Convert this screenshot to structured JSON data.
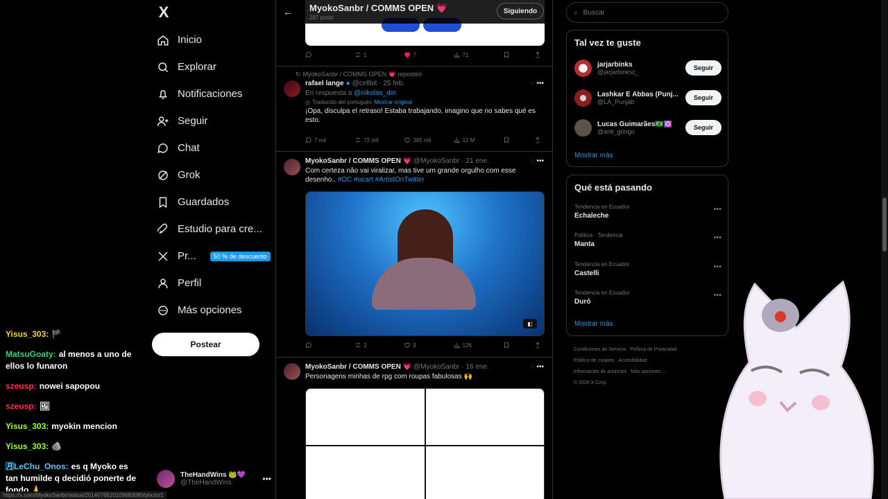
{
  "window_title": "MyokoSanbr / COMMS OPEN",
  "nav": {
    "logo": "X",
    "items": [
      {
        "label": "Inicio",
        "icon": "home-icon"
      },
      {
        "label": "Explorar",
        "icon": "search-icon"
      },
      {
        "label": "Notificaciones",
        "icon": "bell-icon"
      },
      {
        "label": "Seguir",
        "icon": "add-user-icon"
      },
      {
        "label": "Chat",
        "icon": "chat-icon"
      },
      {
        "label": "Grok",
        "icon": "grok-icon"
      },
      {
        "label": "Guardados",
        "icon": "bookmark-icon"
      },
      {
        "label": "Estudio para cre...",
        "icon": "rocket-icon"
      },
      {
        "label": "Pr...",
        "icon": "x-icon",
        "badge": "50 % de descuento"
      },
      {
        "label": "Perfil",
        "icon": "user-icon"
      },
      {
        "label": "Más opciones",
        "icon": "more-icon"
      }
    ],
    "post_button": "Postear",
    "account": {
      "name": "TheHandWins 🐸💜",
      "handle": "@TheHandWins"
    }
  },
  "chat": [
    {
      "user": "Yisus_303:",
      "text": "🏴",
      "color": "#f2d52a"
    },
    {
      "user": "MatsuGoaty:",
      "text": "al menos a uno de ellos lo funaron",
      "color": "#31d37d"
    },
    {
      "user": "szeusp:",
      "text": "nowei sapopou",
      "color": "#ff2e4f"
    },
    {
      "user": "szeusp:",
      "text": "🖼",
      "color": "#ff2e4f"
    },
    {
      "user": "Yisus_303:",
      "text": "myokin mencion",
      "color": "#9aff2d"
    },
    {
      "user": "Yisus_303:",
      "text": "🪨",
      "color": "#9aff2d"
    },
    {
      "user": "🈷LeChu_Onos:",
      "text": "es q Myoko es tan humilde q decidió ponerte de fondo 🙏",
      "color": "#58c7ff"
    }
  ],
  "status_url": "https://x.com/MyokoSanbr/status/2014076520109683080/photo/1",
  "header": {
    "title": "MyokoSanbr / COMMS OPEN 💗",
    "subtitle": "287 posts",
    "follow": "Siguiendo"
  },
  "tweet0": {
    "replies": "",
    "reposts": "1",
    "likes": "7",
    "views": "71"
  },
  "tweet1": {
    "repost_note": "MyokoSanbr / COMMS OPEN 💗 reposteó",
    "name": "rafael lange",
    "handle": "@cellbit",
    "date": "· 25 feb.",
    "reply_prefix": "En respuesta a",
    "reply_to": "@nikolas_dm",
    "translated": "Traducido del portugués",
    "show_original": "Mostrar original",
    "text": "¡Opa, disculpa el retraso! Estaba trabajando, imagino que no sabes qué es esto.",
    "replies": "7 mil",
    "reposts": "72 mil",
    "likes": "385 mil",
    "views": "12 M"
  },
  "tweet2": {
    "name": "MyokoSanbr / COMMS OPEN 💗",
    "handle": "@MyokoSanbr",
    "date": "· 21 ene.",
    "text": "Com certeza não vai viralizar, mas tive um grande orgulho com esse desenho..",
    "tags": "#OC #ocart #ArtistOnTwitter",
    "replies": "",
    "reposts": "2",
    "likes": "9",
    "views": "126"
  },
  "tweet3": {
    "name": "MyokoSanbr / COMMS OPEN 💗",
    "handle": "@MyokoSanbr",
    "date": "· 16 ene.",
    "text": "Personagens minhas de rpg com roupas fabulosas 🙌"
  },
  "sidebar": {
    "search_placeholder": "Buscar",
    "suggest_title": "Tal vez te guste",
    "suggestions": [
      {
        "name": "jarjarbinks",
        "handle": "@jarjarbinksz_",
        "button": "Seguir"
      },
      {
        "name": "Lashkar E Abbas (Punj...",
        "handle": "@LA_Punjab",
        "button": "Seguir"
      },
      {
        "name": "Lucas Guimarães🇧🇷✡️",
        "handle": "@anti_gringo",
        "button": "Seguir"
      }
    ],
    "show_more": "Mostrar más",
    "trends_title": "Qué está pasando",
    "trends": [
      {
        "meta": "Tendencia en Ecuador",
        "topic": "Echaleche"
      },
      {
        "meta": "Política · Tendencia",
        "topic": "Manta"
      },
      {
        "meta": "Tendencia en Ecuador",
        "topic": "Castelli"
      },
      {
        "meta": "Tendencia en Ecuador",
        "topic": "Duró"
      }
    ],
    "trends_more": "Mostrar más",
    "footer": [
      "Condiciones de Servicio",
      "Política de Privacidad",
      "Política de cookies",
      "Accesibilidad",
      "Información de anuncios",
      "Más opciones ...",
      "© 2026 X Corp."
    ]
  }
}
